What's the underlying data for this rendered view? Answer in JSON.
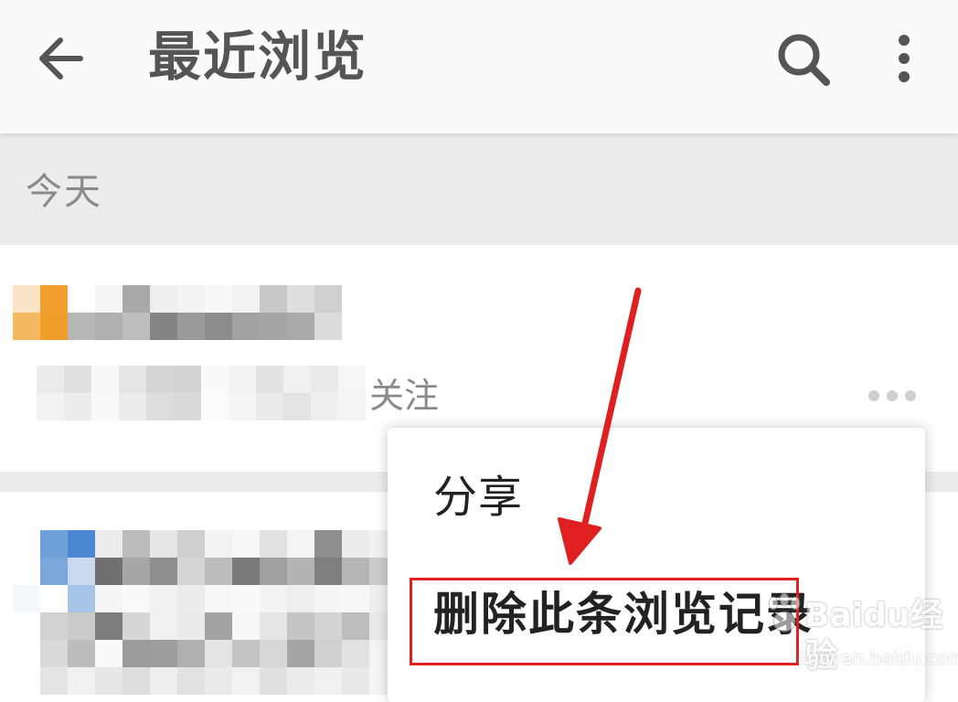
{
  "header": {
    "title": "最近浏览",
    "back_icon": "arrow-left-icon",
    "search_icon": "search-icon",
    "more_icon": "more-vertical-icon"
  },
  "section": {
    "label": "今天"
  },
  "list_item": {
    "meta_suffix": "关注",
    "more_icon": "more-horizontal-icon"
  },
  "menu": {
    "items": [
      {
        "label": "分享"
      },
      {
        "label": "删除此条浏览记录"
      }
    ]
  },
  "annotation": {
    "color": "#e02020"
  },
  "watermark": {
    "brand": "Baidu经验",
    "url": "jingyan.baidu.com"
  }
}
